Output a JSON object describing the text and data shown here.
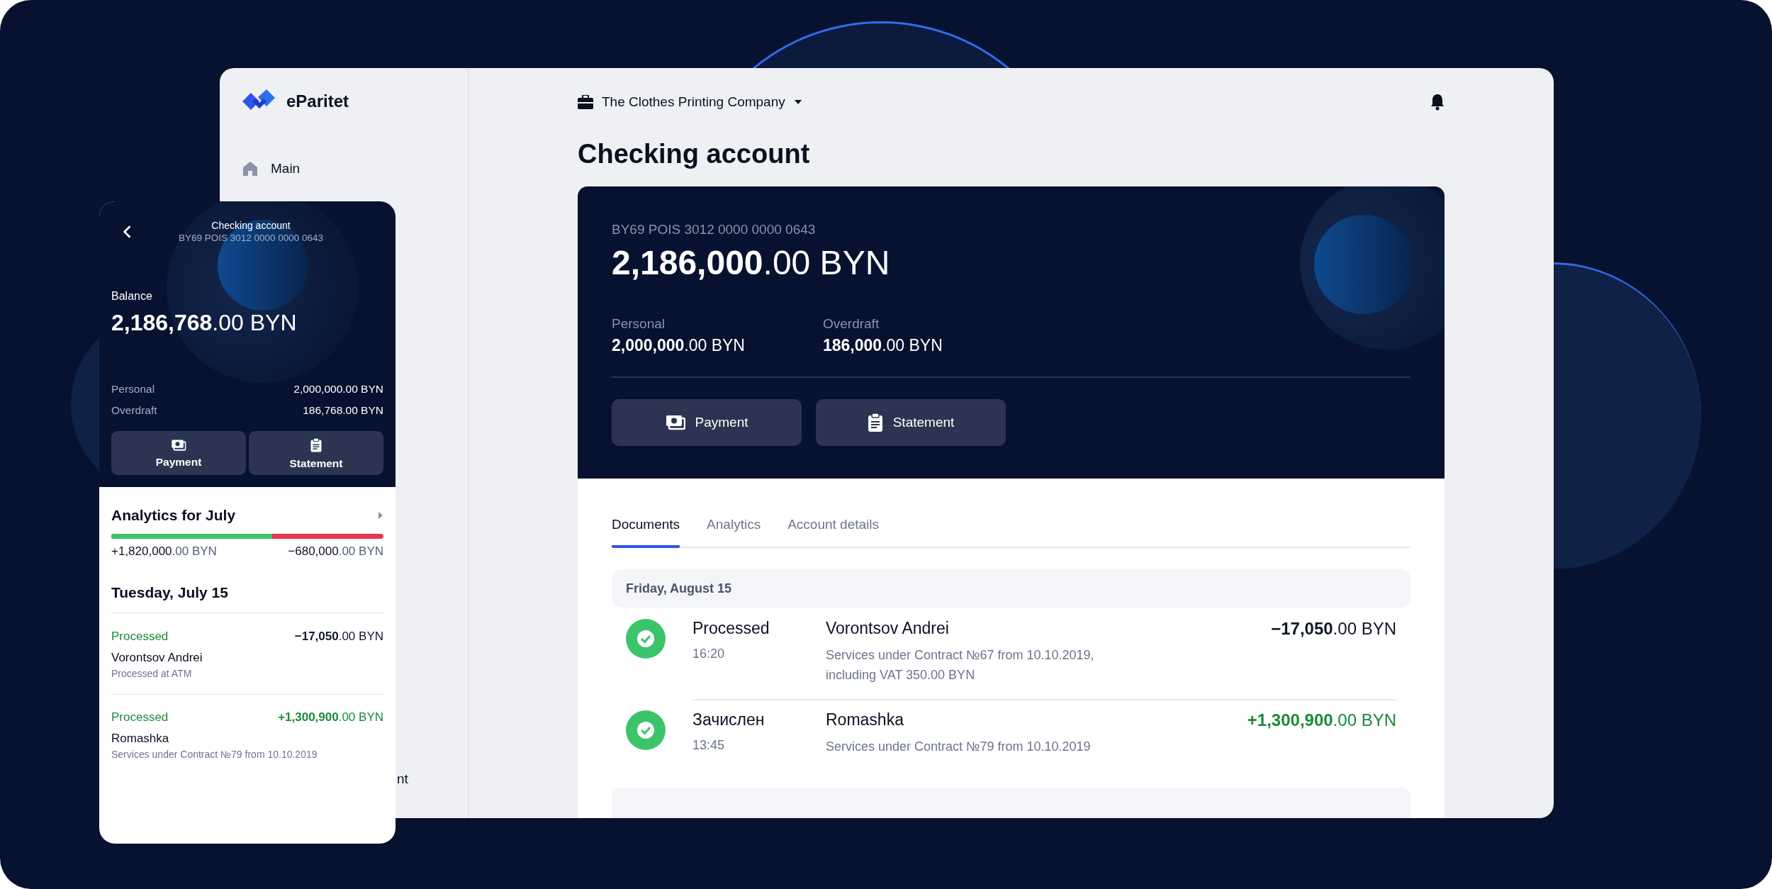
{
  "desktop": {
    "logo": "eParitet",
    "sidebar": {
      "items": [
        {
          "label": "Main",
          "selected": false
        },
        {
          "label": "nt",
          "selected": false
        }
      ]
    },
    "header": {
      "company": "The Clothes Printing Company"
    },
    "title": "Checking account",
    "account": {
      "iban": "BY69 POIS 3012 0000 0000 0643",
      "balance": "**2,186,000**.00 BYN",
      "parts": [
        {
          "label": "Personal",
          "value": "**2,000,000**.00 BYN"
        },
        {
          "label": "Overdraft",
          "value": "**186,000**.00 BYN"
        }
      ],
      "buttons": [
        {
          "kind": "payment",
          "label": "Payment"
        },
        {
          "kind": "statement",
          "label": "Statement"
        }
      ]
    },
    "tabs": [
      {
        "label": "Documents",
        "selected": true
      },
      {
        "label": "Analytics",
        "selected": false
      },
      {
        "label": "Account details",
        "selected": false
      }
    ],
    "groups": [
      {
        "date": "Friday, August 15",
        "transactions": [
          {
            "kind": "debit",
            "status": "Processed",
            "time": "16:20",
            "name": "Vorontsov Andrei",
            "description": "Services under Contract №67 from 10.10.2019, including VAT 350.00 BYN",
            "amount": "**−17,050**.00 BYN"
          },
          {
            "kind": "credit",
            "status": "Зачислен",
            "time": "13:45",
            "name": "Romashka",
            "description": "Services under Contract №79 from 10.10.2019",
            "amount": "**+1,300,900**.00 BYN"
          }
        ]
      }
    ]
  },
  "phone": {
    "title": "Checking account",
    "iban": "BY69 POIS 3012 0000 0000 0643",
    "balance_label": "Balance",
    "balance": "**2,186,768**.00 BYN",
    "parts": [
      {
        "label": "Personal",
        "value": "2,000,000.00 BYN"
      },
      {
        "label": "Overdraft",
        "value": "186,768.00 BYN"
      }
    ],
    "buttons": [
      {
        "kind": "payment",
        "label": "Payment"
      },
      {
        "kind": "statement",
        "label": "Statement"
      }
    ],
    "analytics": {
      "title": "Analytics for July",
      "level": 0.59,
      "income": "**+1,820,000**.00 BYN",
      "expense": "**−680,000**.00 BYN"
    },
    "day": "Tuesday, July 15",
    "transactions": [
      {
        "kind": "debit",
        "status": "Processed",
        "amount": "**−17,050**.00 BYN",
        "name": "Vorontsov Andrei",
        "description": "Processed at ATM"
      },
      {
        "kind": "credit",
        "status": "Processed",
        "amount": "**+1,300,900**.00 BYN",
        "name": "Romashka",
        "description": "Services under Contract №79 from 10.10.2019"
      }
    ]
  }
}
